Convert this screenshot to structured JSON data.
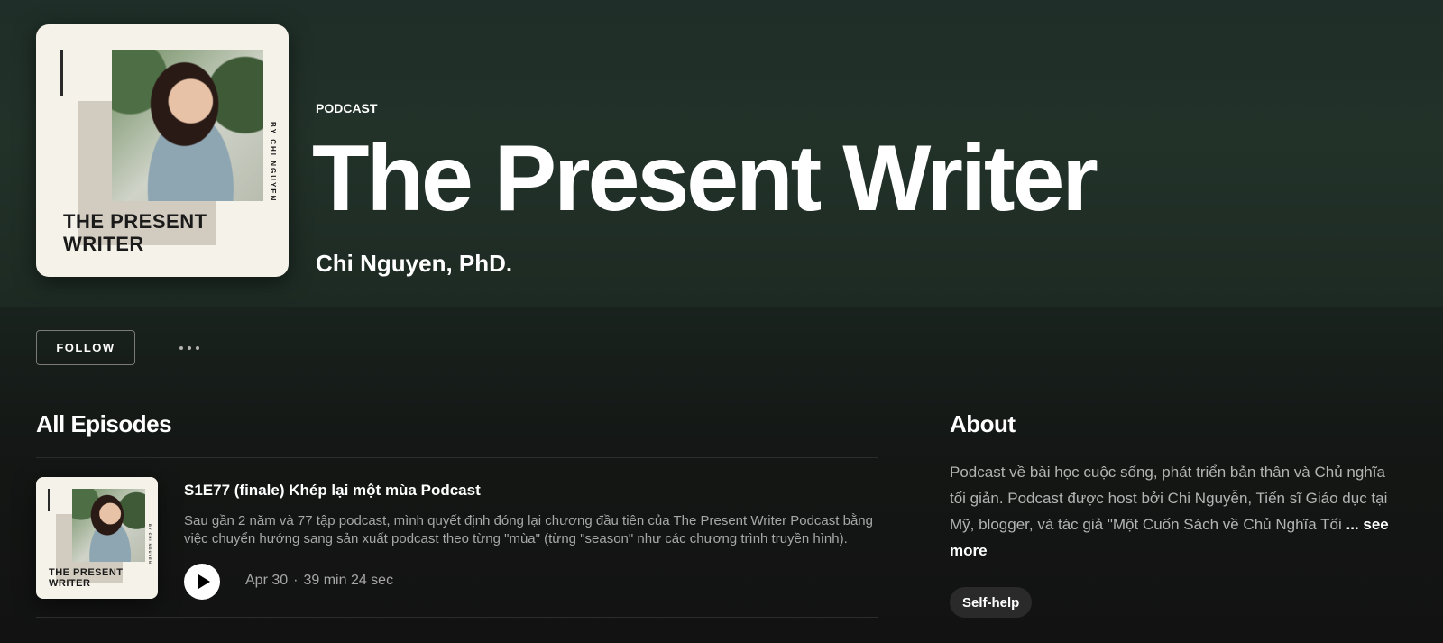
{
  "show": {
    "type_label": "PODCAST",
    "title": "The Present Writer",
    "author": "Chi Nguyen, PhD."
  },
  "cover_art": {
    "title": "THE PRESENT\nWRITER",
    "byline": "BY CHI NGUYEN"
  },
  "actions": {
    "follow_label": "FOLLOW",
    "more_icon": "more-horizontal-icon"
  },
  "episodes": {
    "heading": "All Episodes",
    "items": [
      {
        "title": "S1E77 (finale) Khép lại một mùa Podcast",
        "description": "Sau gần 2 năm và 77 tập podcast, mình quyết định đóng lại chương đầu tiên của The Present Writer Podcast bằng việc chuyển hướng sang sản xuất podcast theo từng \"mùa\" (từng \"season\" như các chương trình truyền hình).",
        "date": "Apr 30",
        "separator": "·",
        "duration": "39 min 24 sec"
      }
    ]
  },
  "about": {
    "heading": "About",
    "text": "Podcast về bài học cuộc sống, phát triển bản thân và Chủ nghĩa tối giản. Podcast được host bởi Chi Nguyễn, Tiến sĩ Giáo dục tại Mỹ, blogger, và tác giả \"Một Cuốn Sách về Chủ Nghĩa Tối",
    "see_more": "... see more",
    "tag": "Self-help"
  }
}
